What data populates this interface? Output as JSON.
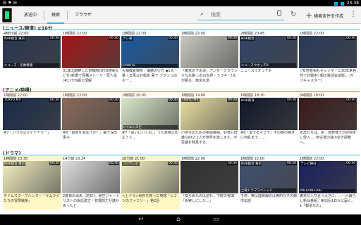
{
  "status": {
    "left": "☰ ⚑ ✉",
    "time": "23:38"
  },
  "tabs": [
    "放送中",
    "検索",
    "ブラウザ"
  ],
  "search": {
    "placeholder": "検索"
  },
  "actions": {
    "add_label": "検索条件を作成"
  },
  "sections": [
    {
      "title": "(ニュース/報道) ≧10分",
      "cards": [
        {
          "time": "4時59前 22:00",
          "ch": "NHK総合 東京",
          "dur": "00:30",
          "cap": "ニュース・気象情報",
          "desc": "",
          "color": "#2a3550"
        },
        {
          "time": "1時間前 22:00",
          "ch": "",
          "dur": "00:30",
          "cap": "",
          "desc": "31歳北朝鮮した前橋時(DVD通販などを)新橋で見構ストーリー原人役(#1)でIS組え理解",
          "color": "#a01818"
        },
        {
          "time": "1時間前 22:00",
          "ch": "テレ東",
          "dur": "00:30",
          "cap": "SPORTS",
          "desc": "大相撲夏場所・優勝の行方 ◆1大一番・日馬以外勢あ 菫ア ブランコのホー...",
          "color": "#1a5aa0"
        },
        {
          "time": "1時間前 22:00",
          "ch": "",
          "dur": "00:30",
          "cap": "",
          "desc": "「東京の下水道」アンダーグラウンドな水路 ◇水の世界・トラキー!水が跳る、東京水道",
          "color": "#c8c8c0"
        },
        {
          "time": "2時間前 20:45",
          "ch": "NHK総合",
          "dur": "00:30",
          "cap": "ニュースウオッチ9",
          "desc": "ニュースウオッチ9",
          "color": "#334466"
        },
        {
          "time": "1時間前 22:00",
          "ch": "",
          "dur": "00:30",
          "cap": "",
          "desc": "▽安倍首相もキャンマーに30年来自然で対戦中▽朝の電話会談秘... (サブキャスター)",
          "color": "#2a3a5a"
        }
      ]
    },
    {
      "title": "(アニメ/特撮)",
      "cards": [
        {
          "time": "1時間前 22:00",
          "ch": "TOKYO MX",
          "dur": "00:30",
          "cap": "",
          "desc": "#7「いつかはマイナアリー」",
          "color": "#1a2a4a"
        },
        {
          "time": "1時間前 22:00",
          "ch": "",
          "dur": "00:30",
          "cap": "",
          "desc": "#8「書道を会ばさか？」曲で深の素子",
          "color": "#8a6a5a"
        },
        {
          "time": "1時間前 20:05",
          "ch": "",
          "dur": "00:30",
          "cap": "ソイエンスビ-",
          "desc": "#7「会いにいくの。」うた素物止めようと...",
          "color": "#d8e8c8"
        },
        {
          "time": "1時間前 19:00",
          "ch": "TOKYO MX",
          "dur": "00:30",
          "cap": "",
          "desc": "小学生のための英語番組。好奇心旺盛なKKと2人が世界を旅します。不思議を発見する。",
          "color": "#e8e0a0"
        },
        {
          "time": "1時間前 18:30",
          "ch": "NHK教育",
          "dur": "00:30",
          "cap": "",
          "desc": "#8「愛するマミヤ」その館の輝きに何処まで……",
          "color": "#101828"
        },
        {
          "time": "5時間前 18:00",
          "ch": "",
          "dur": "00:30",
          "cap": "",
          "desc": "衣蕊たちは、店・宣野博士が研究所に侵入 ... 伊古波の謎の空き屋敷へ。",
          "color": "#3a1a1a"
        }
      ]
    },
    {
      "title": "(ドラマ)",
      "cards": [
        {
          "time": "1時間前 23:30",
          "ch": "NHK総合 東京",
          "dur": "00:30",
          "cap": "",
          "desc": "ダイムスクープハンター「サムライたちの冒険戦争」",
          "color": "#f4f0c0",
          "hl": true
        },
        {
          "time": "14分前 23:24",
          "ch": "",
          "dur": "00:30",
          "cap": "",
          "desc": "2度目の出馬（前日）。晴空ジャーナリストの訴訟建立一管理前だが誰かあったと",
          "color": "#dddddd"
        },
        {
          "time": "28分前 21:00",
          "ch": "フジテレビ",
          "dur": "00:30",
          "cap": "",
          "desc": "<土ドラ>世界を救った英雄「ヒミツのファミリー」第2話",
          "color": "#f4f0c0",
          "hl": true
        },
        {
          "time": "1時間前 22:00",
          "ch": "",
          "dur": "00:30",
          "cap": "",
          "desc": "「知らぬものは語れ」下町の有田「仮実しにした...」",
          "color": "#303030"
        },
        {
          "time": "1時間前 22:00",
          "ch": "NHK総合 東京",
          "dur": "00:30",
          "cap": "土曜ドラマスペシャル",
          "desc": "子供、実は理目線のは実的な子の都市伝説",
          "color": "#405070"
        },
        {
          "time": "1時間前 22:00",
          "ch": "テレビ朝日",
          "dur": "00:30",
          "cap": "MILLION LIVE!",
          "desc": "東京が入り合う大きに、...一人暮らし新仙番組。第2話は日々に届く。1「都道なの」",
          "color": "#1a2060"
        }
      ]
    }
  ]
}
